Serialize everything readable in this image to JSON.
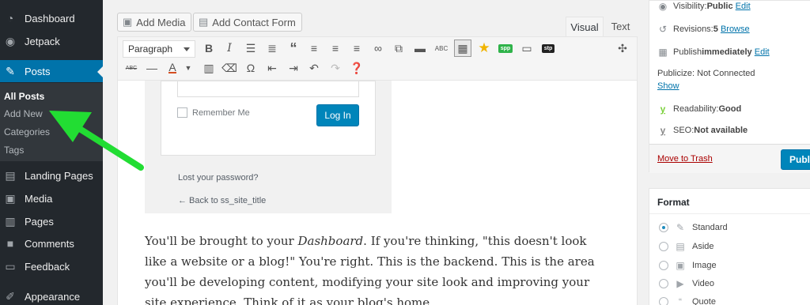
{
  "sidebar": {
    "items": [
      {
        "label": "Dashboard",
        "icon": "dashboard-icon"
      },
      {
        "label": "Jetpack",
        "icon": "jetpack-icon"
      },
      {
        "label": "Posts",
        "icon": "pin-icon"
      },
      {
        "label": "Landing Pages",
        "icon": "pages-icon"
      },
      {
        "label": "Media",
        "icon": "media-icon"
      },
      {
        "label": "Pages",
        "icon": "page-icon"
      },
      {
        "label": "Comments",
        "icon": "comment-icon"
      },
      {
        "label": "Feedback",
        "icon": "feedback-icon"
      },
      {
        "label": "Appearance",
        "icon": "brush-icon"
      }
    ],
    "submenu": [
      "All Posts",
      "Add New",
      "Categories",
      "Tags"
    ]
  },
  "editor": {
    "add_media": "Add Media",
    "add_contact_form": "Add Contact Form",
    "tab_visual": "Visual",
    "tab_text": "Text",
    "format_select": "Paragraph",
    "login_shot": {
      "remember_me": "Remember Me",
      "login_button": "Log In",
      "lost_password": "Lost your password?",
      "back_link": "← Back to ss_site_title"
    },
    "body_lines": [
      "You'll be brought to your ",
      "Dashboard",
      ". If you're thinking, \"this doesn't look",
      "like a website or a blog!\" You're right. This is the backend. This is the area",
      "you'll be developing content, modifying your site look and improving your",
      "site experience. Think of it as your blog's home."
    ]
  },
  "publish": {
    "visibility_label": "Visibility: ",
    "visibility_value": "Public",
    "visibility_edit": "Edit",
    "revisions_label": "Revisions: ",
    "revisions_value": "5",
    "revisions_browse": "Browse",
    "publish_label": "Publish ",
    "publish_value": "immediately",
    "publish_edit": "Edit",
    "publicize": "Publicize: Not Connected",
    "publicize_show": "Show",
    "readability_label": "Readability: ",
    "readability_value": "Good",
    "seo_label": "SEO: ",
    "seo_value": "Not available",
    "trash": "Move to Trash",
    "publish_button": "Publi"
  },
  "format": {
    "title": "Format",
    "options": [
      "Standard",
      "Aside",
      "Image",
      "Video",
      "Quote"
    ],
    "selected": "Standard"
  },
  "colors": {
    "sidebar_bg": "#23282d",
    "accent": "#0073aa",
    "arrow": "#22dd33"
  }
}
